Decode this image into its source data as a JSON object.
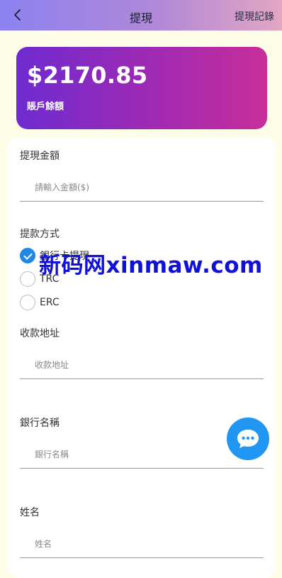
{
  "header": {
    "title": "提現",
    "history_link": "提現記錄",
    "back_icon": "chevron-left-icon"
  },
  "balance": {
    "amount": "$2170.85",
    "label": "賬戶餘額"
  },
  "form": {
    "amount": {
      "label": "提現金額",
      "placeholder": "請輸入金額($)"
    },
    "method": {
      "label": "提款方式",
      "options": [
        {
          "label": "銀行卡提現",
          "checked": true
        },
        {
          "label": "TRC",
          "checked": false
        },
        {
          "label": "ERC",
          "checked": false
        }
      ]
    },
    "address": {
      "label": "收款地址",
      "placeholder": "收款地址"
    },
    "bank": {
      "label": "銀行名稱",
      "placeholder": "銀行名稱"
    },
    "name": {
      "label": "姓名",
      "placeholder": "姓名"
    }
  },
  "watermark": "新码网xinmaw.com",
  "chat_icon": "chat-bubble-icon",
  "colors": {
    "header_gradient": [
      "#8c82f0",
      "#e3a6c2"
    ],
    "card_gradient": [
      "#6e2bd0",
      "#c72e9a"
    ],
    "accent": "#1e88e5",
    "page_bg": "#fdfde8"
  }
}
